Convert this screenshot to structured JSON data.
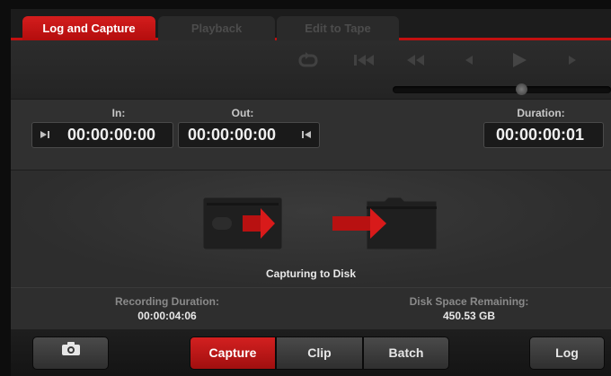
{
  "tabs": [
    {
      "label": "Log and Capture",
      "active": true
    },
    {
      "label": "Playback",
      "active": false
    },
    {
      "label": "Edit to Tape",
      "active": false
    }
  ],
  "transport": {
    "buttons": [
      "loop-icon",
      "go-to-start-icon",
      "rewind-icon",
      "step-back-icon",
      "play-icon",
      "step-forward-icon"
    ]
  },
  "timecode": {
    "in_label": "In:",
    "in_value": "00:00:00:00",
    "out_label": "Out:",
    "out_value": "00:00:00:00",
    "duration_label": "Duration:",
    "duration_value": "00:00:00:01"
  },
  "capture_status": "Capturing to Disk",
  "info": {
    "recording_label": "Recording Duration:",
    "recording_value": "00:00:04:06",
    "disk_label": "Disk Space Remaining:",
    "disk_value": "450.53 GB"
  },
  "bottom": {
    "camera_icon": "camera-icon",
    "capture_label": "Capture",
    "clip_label": "Clip",
    "batch_label": "Batch",
    "log_label": "Log"
  },
  "colors": {
    "accent": "#c21010",
    "background": "#2b2b2b"
  }
}
